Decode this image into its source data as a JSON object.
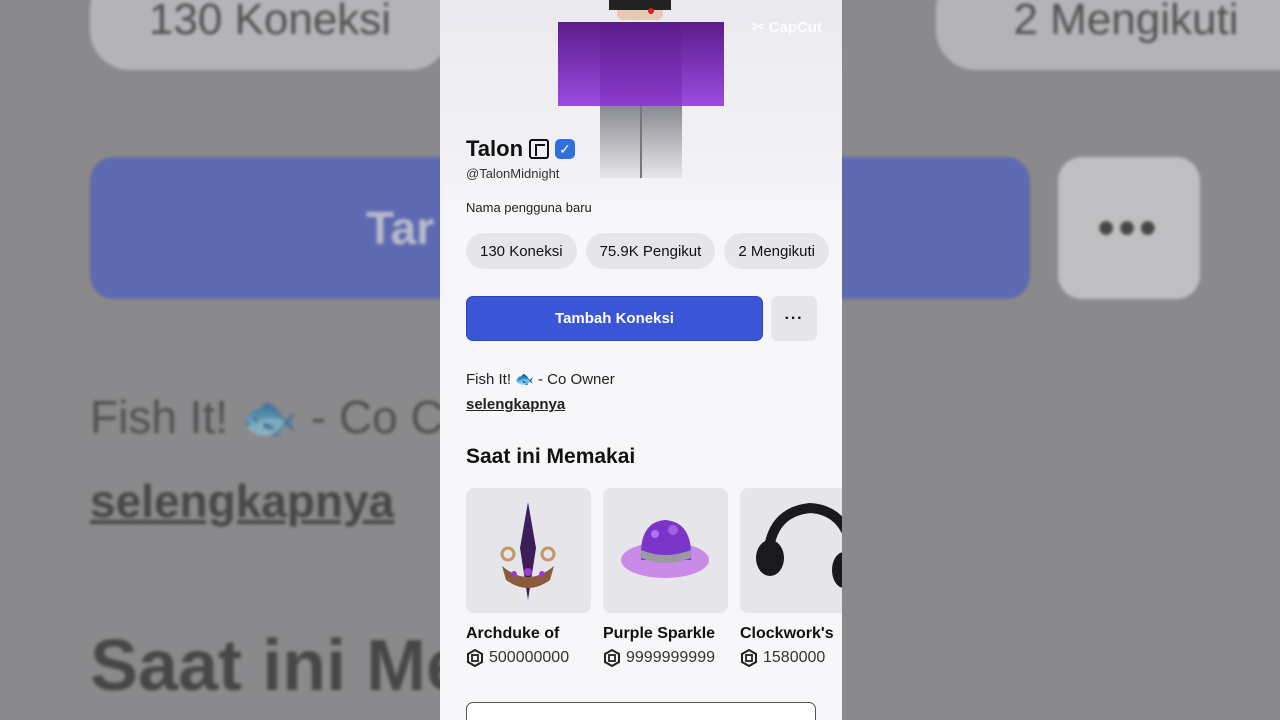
{
  "background": {
    "stat_connections": "130 Koneksi",
    "stat_following": "2 Mengikuti",
    "button_fragment": "Tar",
    "more_label": "•••",
    "bio_fragment": "Fish It! 🐟 - Co C",
    "more_link": "selengkapnya",
    "section_fragment": "Saat ini Me"
  },
  "watermark": "CapCut",
  "profile": {
    "display_name": "Talon",
    "username": "@TalonMidnight",
    "subtitle": "Nama pengguna baru",
    "stats": [
      "130 Koneksi",
      "75.9K Pengikut",
      "2 Mengikuti"
    ],
    "add_connection_label": "Tambah Koneksi",
    "more_label": "···",
    "bio": "Fish It! 🐟 - Co Owner",
    "more_link": "selengkapnya"
  },
  "wearing": {
    "title": "Saat ini Memakai",
    "items": [
      {
        "name": "Archduke of",
        "price": "500000000"
      },
      {
        "name": "Purple Sparkle",
        "price": "9999999999"
      },
      {
        "name": "Clockwork's",
        "price": "1580000"
      }
    ]
  },
  "colors": {
    "accent": "#3a55d6",
    "verified": "#2f6fe0"
  }
}
